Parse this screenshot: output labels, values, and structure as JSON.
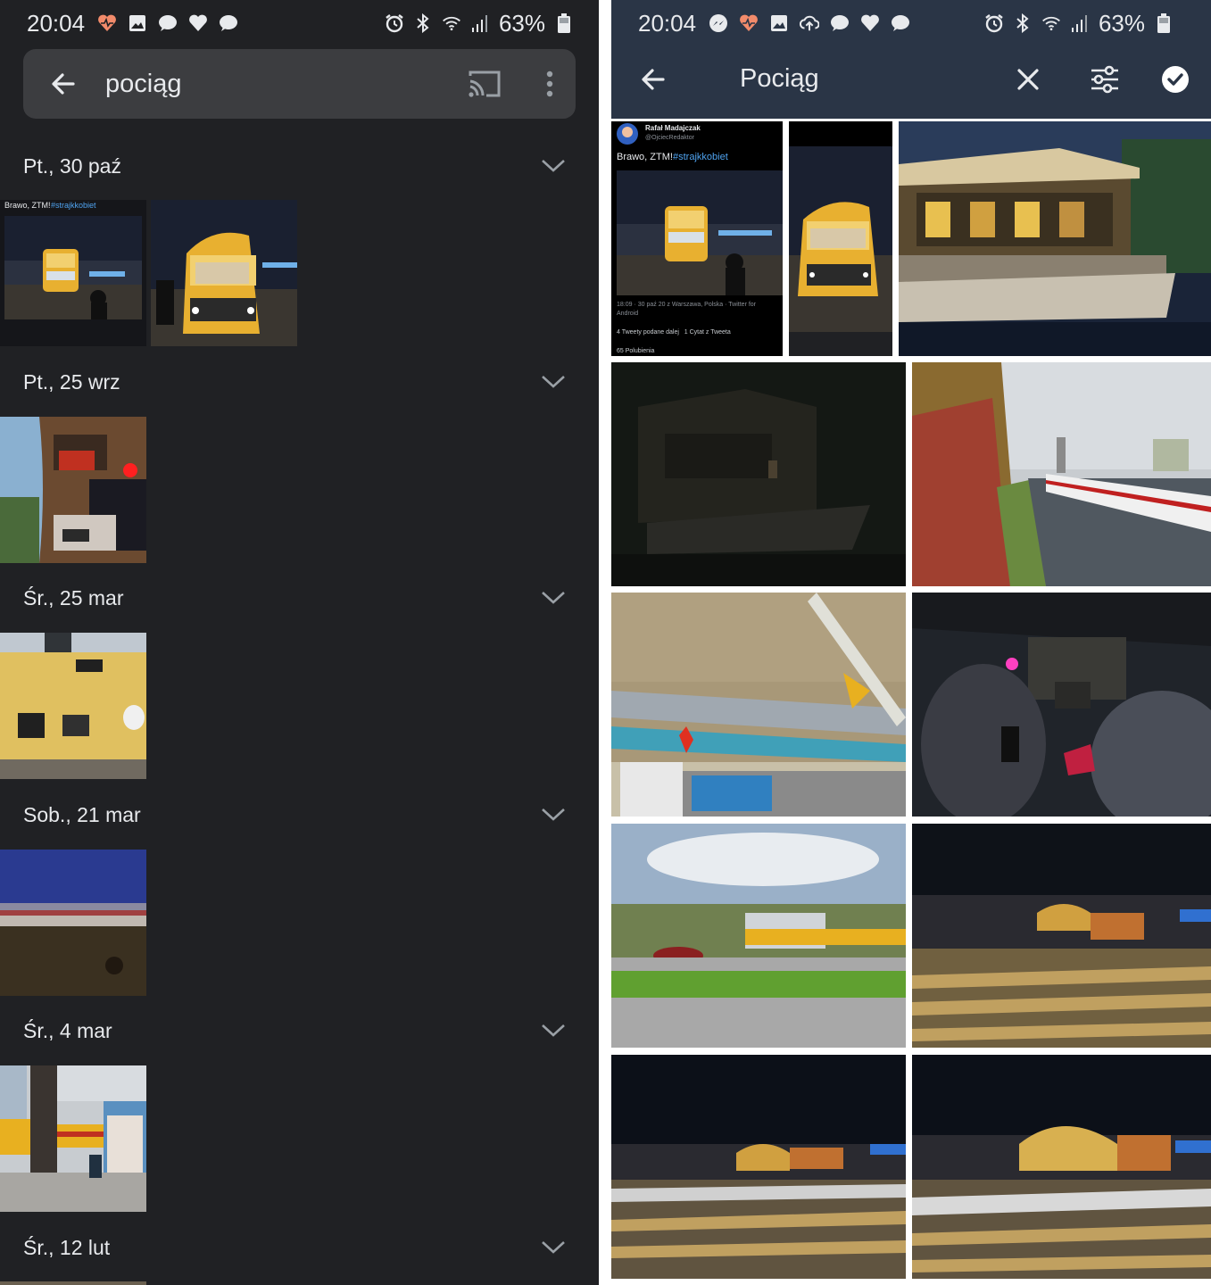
{
  "left": {
    "status": {
      "time": "20:04",
      "battery": "63%",
      "notif_icons": [
        "heart-monitor-icon",
        "image-icon",
        "chat-bubble-icon",
        "heart-icon",
        "chat-bubble-icon"
      ],
      "sys_icons": [
        "alarm-icon",
        "bluetooth-icon",
        "wifi-icon",
        "signal-icon",
        "battery-icon"
      ]
    },
    "search": {
      "query": "pociąg"
    },
    "sections": [
      {
        "label": "Pt., 30 paź"
      },
      {
        "label": "Pt., 25 wrz"
      },
      {
        "label": "Śr., 25 mar"
      },
      {
        "label": "Sob., 21 mar"
      },
      {
        "label": "Śr., 4 mar"
      },
      {
        "label": "Śr., 12 lut"
      }
    ],
    "tweet_thumb": {
      "text": "Brawo, ZTM!",
      "hashtag": "#strajkkobiet"
    }
  },
  "right": {
    "status": {
      "time": "20:04",
      "battery": "63%",
      "notif_icons": [
        "messenger-icon",
        "heart-monitor-icon",
        "image-icon",
        "cloud-upload-icon",
        "chat-bubble-icon",
        "heart-icon",
        "chat-bubble-icon"
      ],
      "sys_icons": [
        "alarm-icon",
        "bluetooth-icon",
        "wifi-icon",
        "signal-icon",
        "battery-icon"
      ]
    },
    "appbar": {
      "title": "Pociąg"
    },
    "tweet": {
      "author": "Rafał Madajczak",
      "handle": "@OjciecRedaktor",
      "text": "Brawo, ZTM!",
      "hashtag": "#strajkkobiet",
      "meta": "18:09 · 30 paź 20 z Warszawa, Polska · Twitter for Android",
      "stats1": "4 Tweety podane dalej   1 Cytat z Tweeta",
      "stats2": "65 Polubienia"
    }
  },
  "colors": {
    "left_bg": "#202124",
    "searchbar_bg": "#3c3d40",
    "right_appbar_bg": "#2a3546",
    "text": "#e8eaed",
    "tweet_link": "#4fa3f0"
  }
}
